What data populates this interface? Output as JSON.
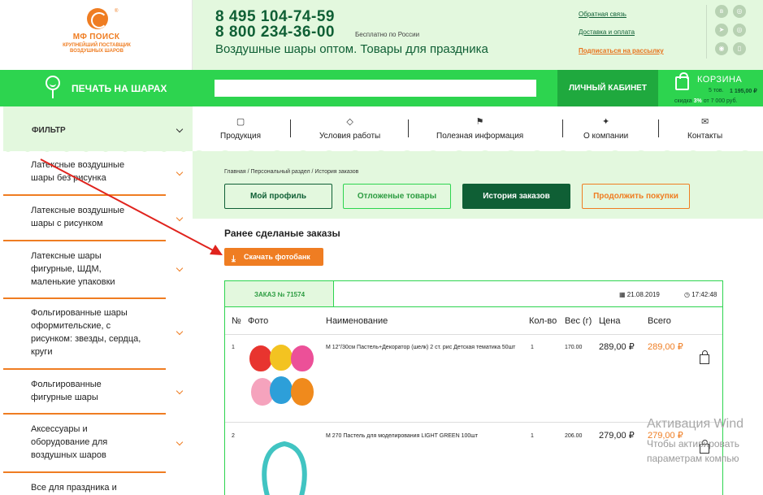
{
  "logo": {
    "name": "МФ ПОИСК",
    "reg": "®",
    "subtitle": "КРУПНЕЙШИЙ ПОСТАВЩИК ВОЗДУШНЫХ ШАРОВ"
  },
  "header": {
    "phone1": "8 495 104-74-59",
    "phone2": "8 800 234-36-00",
    "phone_note": "Бесплатно по России",
    "tagline": "Воздушные шары оптом. Товары для праздника",
    "links": [
      "Обратная связь",
      "Доставка и оплата",
      "Подписаться на рассылку"
    ],
    "social": [
      "vk-icon",
      "instagram-icon",
      "telegram-icon",
      "viber-icon",
      "whatsapp-icon",
      "phone-icon"
    ]
  },
  "bar": {
    "print_label": "ПЕЧАТЬ НА ШАРАХ",
    "search_placeholder": "",
    "cabinet": "ЛИЧНЫЙ КАБИНЕТ",
    "cart_title": "КОРЗИНА",
    "cart_count": "5 тов.",
    "cart_sum": "1 195,00 ₽",
    "cart_disc_pre": "скидка",
    "cart_disc_val": "3%",
    "cart_disc_post": "от 7 000 руб."
  },
  "sidebar": {
    "filter": "ФИЛЬТР",
    "items": [
      "Латексные воздушные шары без рисунка",
      "Латексные воздушные шары с рисунком",
      "Латексные шары фигурные, ШДМ, маленькие упаковки",
      "Фольгированные шары оформительские, с рисунком: звезды, сердца, круги",
      "Фольгированные фигурные шары",
      "Аксессуары и оборудование для воздушных шаров",
      "Все для праздника и"
    ]
  },
  "nav": [
    "Продукция",
    "Условия работы",
    "Полезная информация",
    "О компании",
    "Контакты"
  ],
  "breadcrumb": "Главная / Персональный раздел / История заказов",
  "tabs": [
    "Мой профиль",
    "Отложеные товары",
    "История заказов",
    "Продолжить покупки"
  ],
  "orders": {
    "title": "Ранее сделаные заказы",
    "download": "Скачать фотобанк",
    "order_no": "ЗАКАЗ № 71574",
    "date": "21.08.2019",
    "time": "17:42:48",
    "columns": [
      "№",
      "Фото",
      "Наименование",
      "Кол-во",
      "Вес (г)",
      "Цена",
      "Всего"
    ],
    "rows": [
      {
        "num": "1",
        "name": "М 12\"/30см Пастель+Декоратор (шелк) 2 ст. рис Детская тематика 50шт",
        "qty": "1",
        "weight": "170.00",
        "price": "289,00 ₽",
        "total": "289,00 ₽"
      },
      {
        "num": "2",
        "name": "М 270 Пастель для моделирования LIGHT GREEN 100шт",
        "qty": "1",
        "weight": "206.00",
        "price": "279,00 ₽",
        "total": "279,00 ₽"
      }
    ]
  },
  "watermark": {
    "line1": "Активация Wind",
    "line2": "Чтобы активировать",
    "line3": "параметрам компью"
  },
  "colors": {
    "green": "#2dd44f",
    "dark_green": "#0f5f35",
    "light_green": "#e3f8de",
    "orange": "#ef7d22"
  }
}
